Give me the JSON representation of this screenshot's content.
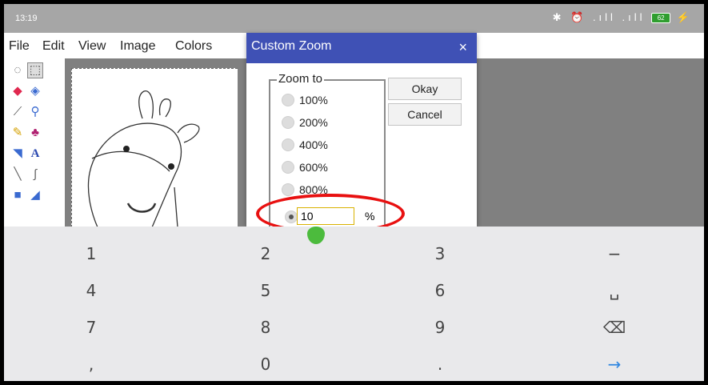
{
  "status_bar": {
    "time": "13:19",
    "icons": "✱ ⏰ .ıll .ıll",
    "battery": "62",
    "charging": "⚡"
  },
  "menu": {
    "items": [
      "File",
      "Edit",
      "View",
      "Image",
      "Colors"
    ]
  },
  "dialog": {
    "title": "Custom Zoom",
    "close": "×",
    "group_label": "Zoom to",
    "options": [
      "100%",
      "200%",
      "400%",
      "600%",
      "800%"
    ],
    "input_value": "10",
    "input_unit": "%",
    "okay_label": "Okay",
    "cancel_label": "Cancel"
  },
  "keyboard": {
    "rows": [
      [
        "1",
        "2",
        "3",
        "−"
      ],
      [
        "4",
        "5",
        "6",
        "␣"
      ],
      [
        "7",
        "8",
        "9",
        "⌫"
      ],
      [
        ",",
        "0",
        ".",
        "→"
      ]
    ]
  },
  "colors": {
    "title_bar": "#3f51b5",
    "highlight": "#e81010",
    "enter_key": "#2f86e0"
  }
}
